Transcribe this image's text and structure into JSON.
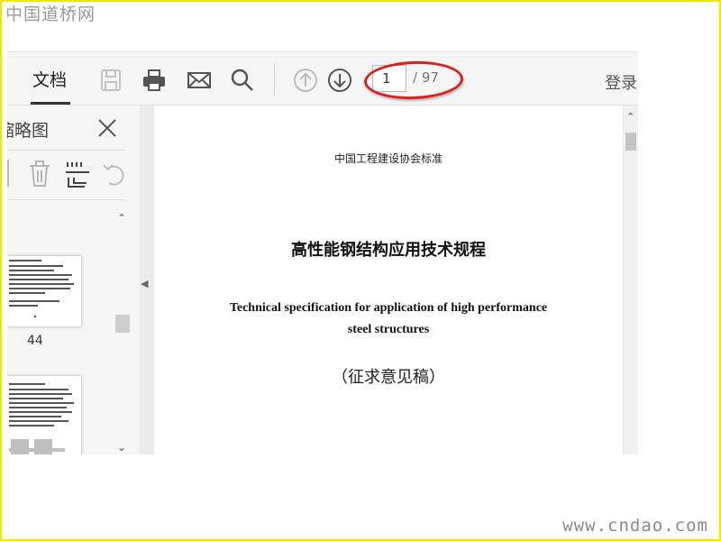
{
  "site": {
    "logo_text": "中国道桥网",
    "watermark_text": "www.cndao.com"
  },
  "toolbar": {
    "doc_tab_label": "文档",
    "icons": [
      "save-icon",
      "print-icon",
      "mail-icon",
      "search-icon",
      "up-arrow-icon",
      "down-arrow-icon"
    ],
    "page_input_value": "1",
    "page_total": "/ 97",
    "login_label": "登录"
  },
  "sidebar": {
    "title": "缩略图",
    "close_icon": "close-icon",
    "tools": [
      "delete-icon",
      "extract-icon",
      "rotate-icon"
    ],
    "thumbnail_label": "44"
  },
  "document": {
    "standard_label": "中国工程建设协会标准",
    "title_cn": "高性能钢结构应用技术规程",
    "title_en_line1": "Technical specification for application of high performance",
    "title_en_line2": "steel structures",
    "draft_label": "（征求意见稿）"
  },
  "colors": {
    "frame_border": "#f2e600",
    "highlight_oval": "#d82020",
    "toolbar_bg": "#f5f5f5"
  }
}
